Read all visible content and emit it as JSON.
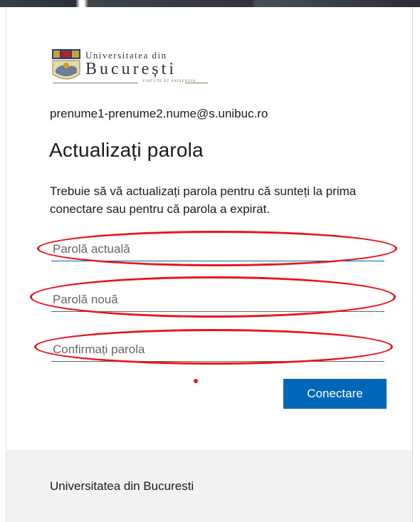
{
  "logo": {
    "line1": "Universitatea din",
    "line2": "București",
    "motto": "VIRTUTE ET SAPIENTIA"
  },
  "account": {
    "email": "prenume1-prenume2.nume@s.unibuc.ro"
  },
  "page": {
    "title": "Actualizați parola",
    "description": "Trebuie să vă actualizați parola pentru că sunteți la prima conectare sau pentru că parola a expirat."
  },
  "form": {
    "current_password": {
      "placeholder": "Parolă actuală",
      "value": ""
    },
    "new_password": {
      "placeholder": "Parolă nouă",
      "value": ""
    },
    "confirm_password": {
      "placeholder": "Confirmați parola",
      "value": ""
    },
    "submit_label": "Conectare"
  },
  "footer": {
    "text": "Universitatea din Bucuresti"
  },
  "colors": {
    "accent": "#0067b8",
    "annotation": "#e8151b",
    "footer_bg": "#f2f2f2"
  }
}
